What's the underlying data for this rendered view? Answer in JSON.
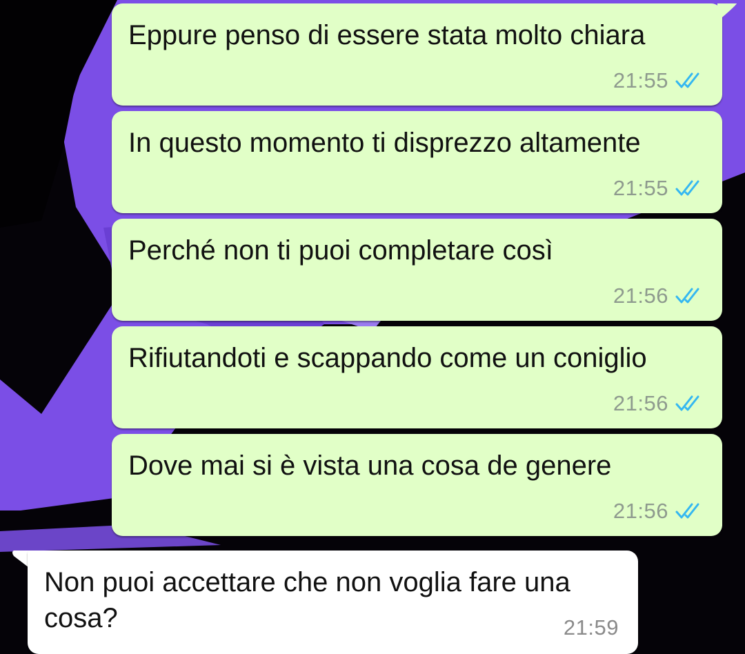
{
  "chat": {
    "messages": [
      {
        "direction": "out",
        "text": "Eppure penso di essere stata molto chiara",
        "time": "21:55",
        "status": "read"
      },
      {
        "direction": "out",
        "text": "In questo momento ti disprezzo altamente",
        "time": "21:55",
        "status": "read"
      },
      {
        "direction": "out",
        "text": "Perché non ti puoi completare così",
        "time": "21:56",
        "status": "read"
      },
      {
        "direction": "out",
        "text": "Rifiutandoti e scappando come un coniglio",
        "time": "21:56",
        "status": "read"
      },
      {
        "direction": "out",
        "text": "Dove mai si è vista una cosa de genere",
        "time": "21:56",
        "status": "read"
      },
      {
        "direction": "in",
        "text": "Non puoi accettare che non voglia fare una cosa?",
        "time": "21:59"
      }
    ]
  },
  "colors": {
    "outgoing_bubble": "#e1ffc7",
    "incoming_bubble": "#ffffff",
    "read_tick": "#34b7f1",
    "wallpaper_accent": "#7b4ee6"
  }
}
